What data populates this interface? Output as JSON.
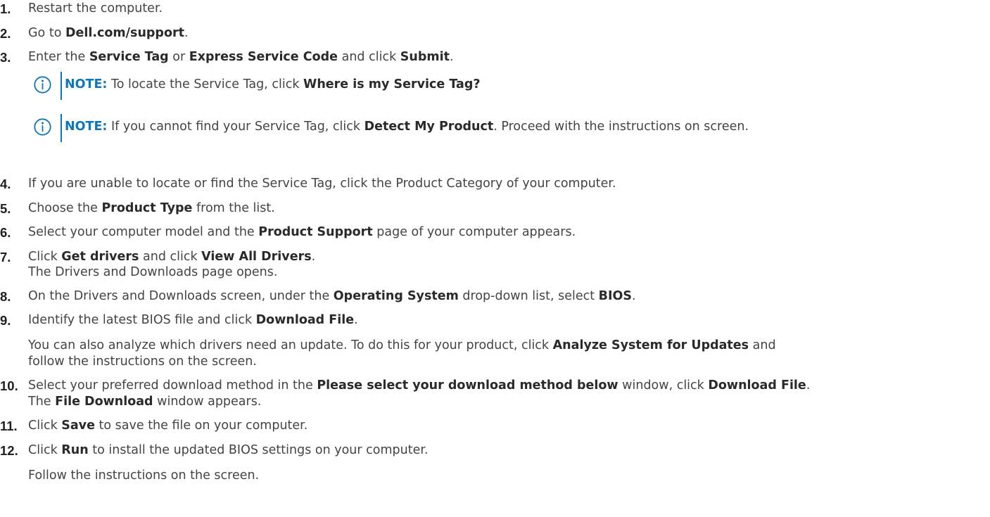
{
  "steps": [
    {
      "num": "1.",
      "parts": [
        {
          "t": "Restart the computer."
        }
      ]
    },
    {
      "num": "2.",
      "parts": [
        {
          "t": "Go to "
        },
        {
          "t": "Dell.com/support",
          "b": true
        },
        {
          "t": "."
        }
      ]
    },
    {
      "num": "3.",
      "parts": [
        {
          "t": "Enter the "
        },
        {
          "t": "Service Tag",
          "b": true
        },
        {
          "t": " or "
        },
        {
          "t": "Express Service Code",
          "b": true
        },
        {
          "t": " and click "
        },
        {
          "t": "Submit",
          "b": true
        },
        {
          "t": "."
        }
      ]
    },
    {
      "num": "4.",
      "parts": [
        {
          "t": "If you are unable to locate or find the Service Tag, click the Product Category of your computer."
        }
      ]
    },
    {
      "num": "5.",
      "parts": [
        {
          "t": "Choose the "
        },
        {
          "t": "Product Type",
          "b": true
        },
        {
          "t": " from the list."
        }
      ]
    },
    {
      "num": "6.",
      "parts": [
        {
          "t": "Select your computer model and the "
        },
        {
          "t": "Product Support",
          "b": true
        },
        {
          "t": " page of your computer appears."
        }
      ]
    },
    {
      "num": "7.",
      "parts": [
        {
          "t": "Click "
        },
        {
          "t": "Get drivers",
          "b": true
        },
        {
          "t": " and click "
        },
        {
          "t": "View All Drivers",
          "b": true
        },
        {
          "t": "."
        }
      ]
    },
    {
      "num": "8.",
      "parts": [
        {
          "t": "On the Drivers and Downloads screen, under the "
        },
        {
          "t": "Operating System",
          "b": true
        },
        {
          "t": " drop-down list, select "
        },
        {
          "t": "BIOS",
          "b": true
        },
        {
          "t": "."
        }
      ]
    },
    {
      "num": "9.",
      "parts": [
        {
          "t": "Identify the latest BIOS file and click "
        },
        {
          "t": "Download File",
          "b": true
        },
        {
          "t": "."
        }
      ]
    },
    {
      "num": "10.",
      "parts": [
        {
          "t": "Select your preferred download method in the "
        },
        {
          "t": "Please select your download method below",
          "b": true
        },
        {
          "t": " window, click "
        },
        {
          "t": "Download File",
          "b": true
        },
        {
          "t": "."
        }
      ]
    },
    {
      "num": "11.",
      "parts": [
        {
          "t": "Click "
        },
        {
          "t": "Save",
          "b": true
        },
        {
          "t": " to save the file on your computer."
        }
      ]
    },
    {
      "num": "12.",
      "parts": [
        {
          "t": "Click "
        },
        {
          "t": "Run",
          "b": true
        },
        {
          "t": " to install the updated BIOS settings on your computer."
        }
      ]
    }
  ],
  "subs": [
    {
      "parts": [
        {
          "t": "The Drivers and Downloads page opens."
        }
      ]
    },
    {
      "parts": [
        {
          "t": "You can also analyze which drivers need an update. To do this for your product, click "
        },
        {
          "t": "Analyze System for Updates",
          "b": true
        },
        {
          "t": " and"
        }
      ]
    },
    {
      "parts": [
        {
          "t": "follow the instructions on the screen."
        }
      ]
    },
    {
      "parts": [
        {
          "t": "The "
        },
        {
          "t": "File Download",
          "b": true
        },
        {
          "t": " window appears."
        }
      ]
    },
    {
      "parts": [
        {
          "t": "Follow the instructions on the screen."
        }
      ]
    }
  ],
  "notes": [
    {
      "label": "NOTE:",
      "parts": [
        {
          "t": " To locate the Service Tag, click "
        },
        {
          "t": "Where is my Service Tag?",
          "b": true
        }
      ]
    },
    {
      "label": "NOTE:",
      "parts": [
        {
          "t": " If you cannot find your Service Tag, click "
        },
        {
          "t": "Detect My Product",
          "b": true
        },
        {
          "t": ". Proceed with the instructions on screen."
        }
      ]
    }
  ],
  "colors": {
    "note_accent": "#0e76bc",
    "body_text": "#444444"
  },
  "icons": {
    "note": "info-circle-icon"
  }
}
